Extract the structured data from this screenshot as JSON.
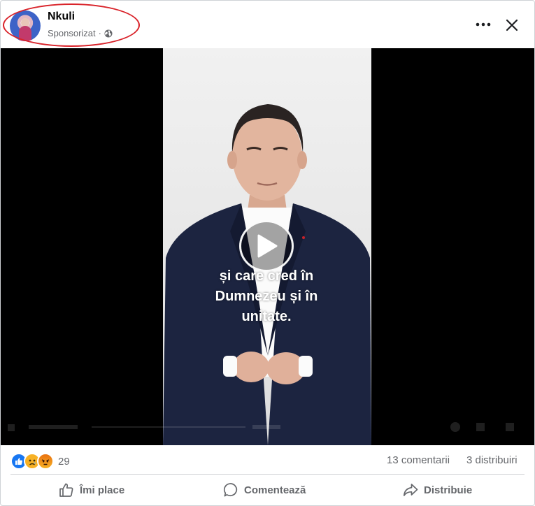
{
  "post": {
    "page_name": "Nkuli",
    "sponsored_label": "Sponsorizat",
    "separator": "·",
    "privacy_icon": "globe-icon",
    "more_icon": "more-options-icon",
    "close_icon": "close-icon"
  },
  "video": {
    "caption_lines": [
      "și care cred în",
      "Dumnezeu și în",
      "unitate."
    ],
    "play_icon": "play-icon"
  },
  "reactions": {
    "icons": [
      "like-icon",
      "sad-icon",
      "angry-icon"
    ],
    "count": "29",
    "comments": "13 comentarii",
    "shares": "3 distribuiri"
  },
  "actions": {
    "like_label": "Îmi place",
    "comment_label": "Comentează",
    "share_label": "Distribuie"
  },
  "colors": {
    "highlight": "#d9232a",
    "like_blue": "#1877f2",
    "text_secondary": "#65676b",
    "suit": "#1c2440"
  }
}
